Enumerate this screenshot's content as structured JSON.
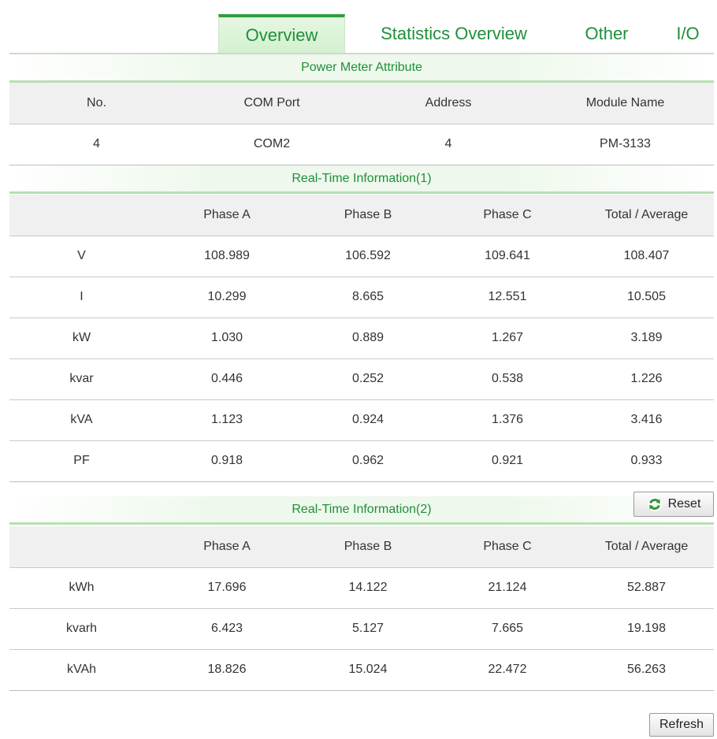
{
  "tabs": [
    {
      "label": "Overview",
      "active": true
    },
    {
      "label": "Statistics Overview",
      "active": false
    },
    {
      "label": "Other",
      "active": false
    },
    {
      "label": "I/O",
      "active": false
    }
  ],
  "attribute": {
    "title": "Power Meter Attribute",
    "headers": [
      "No.",
      "COM Port",
      "Address",
      "Module Name"
    ],
    "values": [
      "4",
      "COM2",
      "4",
      "PM-3133"
    ]
  },
  "realtime1": {
    "title": "Real-Time Information(1)",
    "headers": [
      "",
      "Phase A",
      "Phase B",
      "Phase C",
      "Total / Average"
    ],
    "rows": [
      [
        "V",
        "108.989",
        "106.592",
        "109.641",
        "108.407"
      ],
      [
        "I",
        "10.299",
        "8.665",
        "12.551",
        "10.505"
      ],
      [
        "kW",
        "1.030",
        "0.889",
        "1.267",
        "3.189"
      ],
      [
        "kvar",
        "0.446",
        "0.252",
        "0.538",
        "1.226"
      ],
      [
        "kVA",
        "1.123",
        "0.924",
        "1.376",
        "3.416"
      ],
      [
        "PF",
        "0.918",
        "0.962",
        "0.921",
        "0.933"
      ]
    ]
  },
  "realtime2": {
    "title": "Real-Time Information(2)",
    "reset_label": "Reset",
    "headers": [
      "",
      "Phase A",
      "Phase B",
      "Phase C",
      "Total / Average"
    ],
    "rows": [
      [
        "kWh",
        "17.696",
        "14.122",
        "21.124",
        "52.887"
      ],
      [
        "kvarh",
        "6.423",
        "5.127",
        "7.665",
        "19.198"
      ],
      [
        "kVAh",
        "18.826",
        "15.024",
        "22.472",
        "56.263"
      ]
    ]
  },
  "refresh_label": "Refresh",
  "colors": {
    "accent": "#2e9e3e",
    "tab_text": "#1f8f3a",
    "header_bg": "#f0f0f0"
  }
}
